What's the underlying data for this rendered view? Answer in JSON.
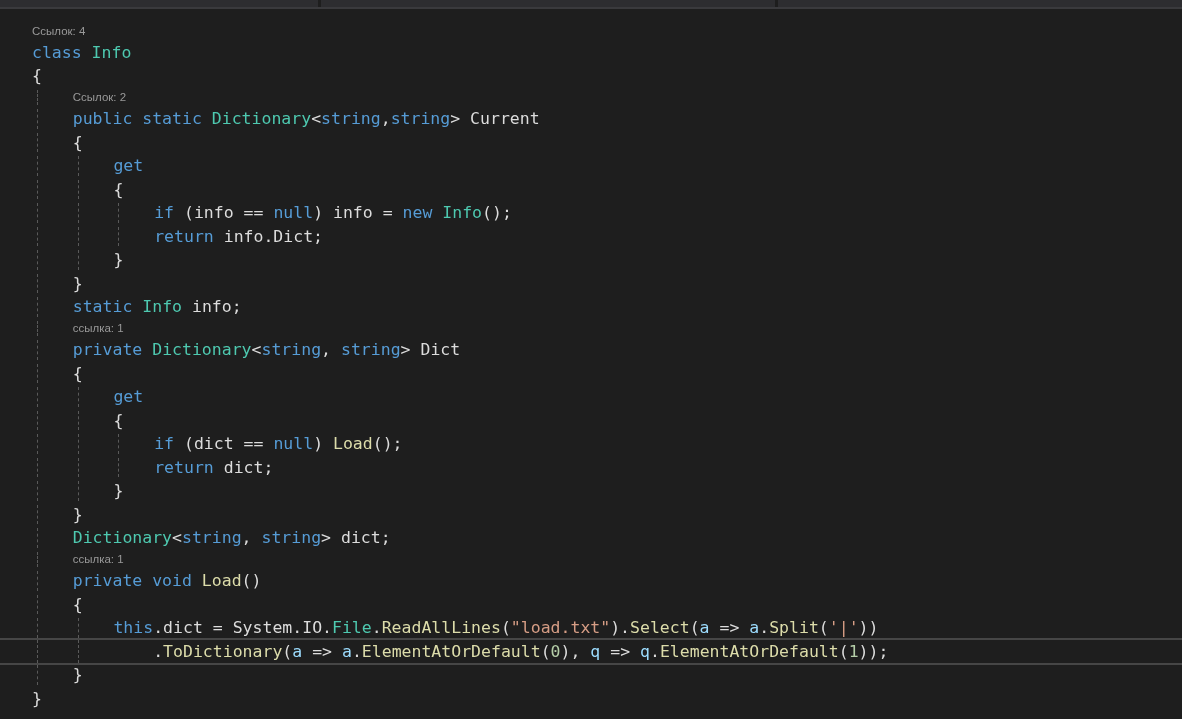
{
  "lines": [
    {
      "kind": "lens",
      "text": "Ссылок: 4"
    },
    {
      "kind": "code",
      "current": false,
      "tokens": [
        {
          "text": "class ",
          "kind": "kw"
        },
        {
          "text": "Info",
          "kind": "type"
        }
      ]
    },
    {
      "kind": "code",
      "current": false,
      "tokens": [
        {
          "text": "{",
          "kind": "open"
        }
      ]
    },
    {
      "kind": "lens",
      "text": "Ссылок: 2"
    },
    {
      "kind": "code",
      "current": false,
      "tokens": [
        {
          "text": "public static ",
          "kind": "kw"
        },
        {
          "text": "Dictionary",
          "kind": "type"
        },
        {
          "text": "<",
          "kind": "plain"
        },
        {
          "text": "string",
          "kind": "kw"
        },
        {
          "text": ",",
          "kind": "plain"
        },
        {
          "text": "string",
          "kind": "kw"
        },
        {
          "text": "> Current",
          "kind": "plain"
        }
      ]
    },
    {
      "kind": "code",
      "current": false,
      "tokens": [
        {
          "text": "{",
          "kind": "open"
        }
      ]
    },
    {
      "kind": "code",
      "current": false,
      "tokens": [
        {
          "text": "get",
          "kind": "kw"
        }
      ]
    },
    {
      "kind": "code",
      "current": false,
      "tokens": [
        {
          "text": "{",
          "kind": "open"
        }
      ]
    },
    {
      "kind": "code",
      "current": false,
      "tokens": [
        {
          "text": "if",
          "kind": "kw"
        },
        {
          "text": " (info == ",
          "kind": "plain"
        },
        {
          "text": "null",
          "kind": "kw"
        },
        {
          "text": ") info = ",
          "kind": "plain"
        },
        {
          "text": "new ",
          "kind": "kw"
        },
        {
          "text": "Info",
          "kind": "type"
        },
        {
          "text": "();",
          "kind": "plain"
        }
      ]
    },
    {
      "kind": "code",
      "current": false,
      "tokens": [
        {
          "text": "return",
          "kind": "kw"
        },
        {
          "text": " info.Dict;",
          "kind": "plain"
        }
      ]
    },
    {
      "kind": "code",
      "current": false,
      "tokens": [
        {
          "text": "}",
          "kind": "close"
        }
      ]
    },
    {
      "kind": "code",
      "current": false,
      "tokens": [
        {
          "text": "}",
          "kind": "close"
        }
      ]
    },
    {
      "kind": "code",
      "current": false,
      "tokens": [
        {
          "text": "static ",
          "kind": "kw"
        },
        {
          "text": "Info",
          "kind": "type"
        },
        {
          "text": " info;",
          "kind": "plain"
        }
      ]
    },
    {
      "kind": "lens",
      "text": "ссылка: 1"
    },
    {
      "kind": "code",
      "current": false,
      "tokens": [
        {
          "text": "private ",
          "kind": "kw"
        },
        {
          "text": "Dictionary",
          "kind": "type"
        },
        {
          "text": "<",
          "kind": "plain"
        },
        {
          "text": "string",
          "kind": "kw"
        },
        {
          "text": ", ",
          "kind": "plain"
        },
        {
          "text": "string",
          "kind": "kw"
        },
        {
          "text": "> Dict",
          "kind": "plain"
        }
      ]
    },
    {
      "kind": "code",
      "current": false,
      "tokens": [
        {
          "text": "{",
          "kind": "open"
        }
      ]
    },
    {
      "kind": "code",
      "current": false,
      "tokens": [
        {
          "text": "get",
          "kind": "kw"
        }
      ]
    },
    {
      "kind": "code",
      "current": false,
      "tokens": [
        {
          "text": "{",
          "kind": "open"
        }
      ]
    },
    {
      "kind": "code",
      "current": false,
      "tokens": [
        {
          "text": "if",
          "kind": "kw"
        },
        {
          "text": " (dict == ",
          "kind": "plain"
        },
        {
          "text": "null",
          "kind": "kw"
        },
        {
          "text": ") ",
          "kind": "plain"
        },
        {
          "text": "Load",
          "kind": "method"
        },
        {
          "text": "();",
          "kind": "plain"
        }
      ]
    },
    {
      "kind": "code",
      "current": false,
      "tokens": [
        {
          "text": "return",
          "kind": "kw"
        },
        {
          "text": " dict;",
          "kind": "plain"
        }
      ]
    },
    {
      "kind": "code",
      "current": false,
      "tokens": [
        {
          "text": "}",
          "kind": "close"
        }
      ]
    },
    {
      "kind": "code",
      "current": false,
      "tokens": [
        {
          "text": "}",
          "kind": "close"
        }
      ]
    },
    {
      "kind": "code",
      "current": false,
      "tokens": [
        {
          "text": "Dictionary",
          "kind": "type"
        },
        {
          "text": "<",
          "kind": "plain"
        },
        {
          "text": "string",
          "kind": "kw"
        },
        {
          "text": ", ",
          "kind": "plain"
        },
        {
          "text": "string",
          "kind": "kw"
        },
        {
          "text": "> dict;",
          "kind": "plain"
        }
      ]
    },
    {
      "kind": "lens",
      "text": "ссылка: 1"
    },
    {
      "kind": "code",
      "current": false,
      "tokens": [
        {
          "text": "private void ",
          "kind": "kw"
        },
        {
          "text": "Load",
          "kind": "method"
        },
        {
          "text": "()",
          "kind": "plain"
        }
      ]
    },
    {
      "kind": "code",
      "current": false,
      "tokens": [
        {
          "text": "{",
          "kind": "open"
        }
      ]
    },
    {
      "kind": "code",
      "current": false,
      "tokens": [
        {
          "text": "this",
          "kind": "kw"
        },
        {
          "text": ".dict = System.IO.",
          "kind": "plain"
        },
        {
          "text": "File",
          "kind": "type"
        },
        {
          "text": ".",
          "kind": "plain"
        },
        {
          "text": "ReadAllLines",
          "kind": "method"
        },
        {
          "text": "(",
          "kind": "plain"
        },
        {
          "text": "\"load.txt\"",
          "kind": "string"
        },
        {
          "text": ").",
          "kind": "plain"
        },
        {
          "text": "Select",
          "kind": "method"
        },
        {
          "text": "(",
          "kind": "plain"
        },
        {
          "text": "a",
          "kind": "param"
        },
        {
          "text": " => ",
          "kind": "plain"
        },
        {
          "text": "a",
          "kind": "param"
        },
        {
          "text": ".",
          "kind": "plain"
        },
        {
          "text": "Split",
          "kind": "method"
        },
        {
          "text": "(",
          "kind": "plain"
        },
        {
          "text": "'|'",
          "kind": "string"
        },
        {
          "text": "))",
          "kind": "plain"
        }
      ]
    },
    {
      "kind": "continuation",
      "current": true,
      "tokens": [
        {
          "text": ".",
          "kind": "plain"
        },
        {
          "text": "ToDictionary",
          "kind": "method"
        },
        {
          "text": "(",
          "kind": "plain"
        },
        {
          "text": "a",
          "kind": "param"
        },
        {
          "text": " => ",
          "kind": "plain"
        },
        {
          "text": "a",
          "kind": "param"
        },
        {
          "text": ".",
          "kind": "plain"
        },
        {
          "text": "ElementAtOrDefault",
          "kind": "method"
        },
        {
          "text": "(",
          "kind": "plain"
        },
        {
          "text": "0",
          "kind": "number"
        },
        {
          "text": "), ",
          "kind": "plain"
        },
        {
          "text": "q",
          "kind": "param"
        },
        {
          "text": " => ",
          "kind": "plain"
        },
        {
          "text": "q",
          "kind": "param"
        },
        {
          "text": ".",
          "kind": "plain"
        },
        {
          "text": "ElementAtOrDefault",
          "kind": "method"
        },
        {
          "text": "(",
          "kind": "plain"
        },
        {
          "text": "1",
          "kind": "number"
        },
        {
          "text": "));",
          "kind": "plain"
        }
      ]
    },
    {
      "kind": "code",
      "current": false,
      "tokens": [
        {
          "text": "}",
          "kind": "close"
        }
      ]
    },
    {
      "kind": "code",
      "current": false,
      "tokens": [
        {
          "text": "}",
          "kind": "close"
        }
      ]
    }
  ]
}
